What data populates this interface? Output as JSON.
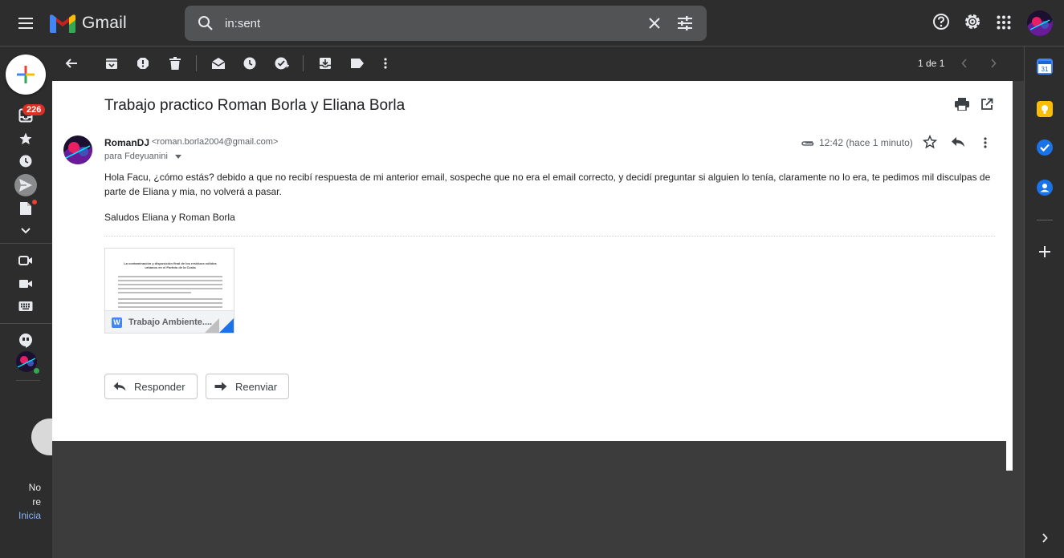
{
  "app": {
    "name": "Gmail"
  },
  "search": {
    "value": "in:sent"
  },
  "rail": {
    "inbox_count": "226",
    "bottom_text_1": "No",
    "bottom_text_2": "re",
    "bottom_link": "Inicia"
  },
  "toolbar": {
    "pager": "1 de 1"
  },
  "email": {
    "subject": "Trabajo practico Roman Borla y Eliana Borla",
    "sender_name": "RomanDJ",
    "sender_email": "<roman.borla2004@gmail.com>",
    "recipient": "para Fdeyuanini",
    "time": "12:42 (hace 1 minuto)",
    "body": "Hola Facu, ¿cómo estás? debido a que no recibí respuesta de mi anterior email, sospeche que no era el email correcto, y decidí preguntar si alguien lo tenía, claramente no lo era, te pedimos mil disculpas de parte de Eliana y mia, no volverá a pasar.",
    "signature": "Saludos Eliana y Roman Borla",
    "attachment": {
      "name": "Trabajo Ambiente....",
      "type_letter": "W",
      "preview_title": "La contaminación y disposición final de los residuos sólidos urbanos en el Partido de la Costa"
    }
  },
  "actions": {
    "reply": "Responder",
    "forward": "Reenviar"
  },
  "colors": {
    "accent": "#1a73e8",
    "badge": "#d93025",
    "online": "#34a853"
  }
}
